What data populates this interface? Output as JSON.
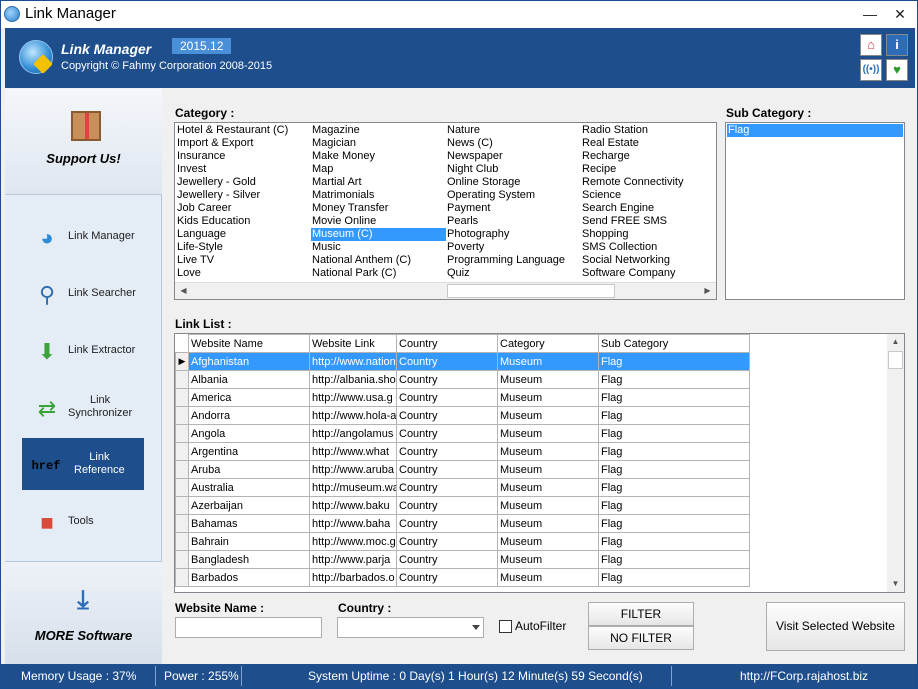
{
  "window": {
    "title": "Link Manager",
    "minimize": "—",
    "close": "✕"
  },
  "header": {
    "name": "Link Manager",
    "version": "2015.12",
    "copyright": "Copyright © Fahmy Corporation 2008-2015"
  },
  "sidebar": {
    "support": "Support Us!",
    "items": [
      {
        "label": "Link Manager",
        "icon": "globe-key-icon"
      },
      {
        "label": "Link Searcher",
        "icon": "magnifier-icon"
      },
      {
        "label": "Link Extractor",
        "icon": "green-arrow-down-icon"
      },
      {
        "label": "Link\nSynchronizer",
        "icon": "sync-arrows-icon"
      },
      {
        "label": "Link\nReference",
        "icon": "href-icon",
        "icon_text": "href",
        "active": true
      },
      {
        "label": "Tools",
        "icon": "cubes-icon"
      }
    ],
    "more": "MORE Software"
  },
  "category": {
    "label": "Category :",
    "columns": [
      [
        "Hotel & Restaurant (C)",
        "Import & Export",
        "Insurance",
        "Invest",
        "Jewellery - Gold",
        "Jewellery - Silver",
        "Job Career",
        "Kids Education",
        "Language",
        "Life-Style",
        "Live TV",
        "Love"
      ],
      [
        "Magazine",
        "Magician",
        "Make Money",
        "Map",
        "Martial Art",
        "Matrimonials",
        "Money Transfer",
        "Movie Online",
        "Museum (C)",
        "Music",
        "National Anthem (C)",
        "National Park (C)"
      ],
      [
        "Nature",
        "News (C)",
        "Newspaper",
        "Night Club",
        "Online Storage",
        "Operating System",
        "Payment",
        "Pearls",
        "Photography",
        "Poverty",
        "Programming Language",
        "Quiz"
      ],
      [
        "Radio Station",
        "Real Estate",
        "Recharge",
        "Recipe",
        "Remote Connectivity",
        "Science",
        "Search Engine",
        "Send FREE SMS",
        "Shopping",
        "SMS Collection",
        "Social Networking",
        "Software Company"
      ]
    ],
    "selected": "Museum (C)"
  },
  "subcategory": {
    "label": "Sub Category :",
    "items": [
      "Flag"
    ],
    "selected": "Flag"
  },
  "linklist": {
    "label": "Link List :",
    "headers": [
      "Website Name",
      "Website Link",
      "Country",
      "Category",
      "Sub Category"
    ],
    "rows": [
      [
        "Afghanistan",
        "http://www.nation",
        "Country",
        "Museum",
        "Flag"
      ],
      [
        "Albania",
        "http://albania.sho",
        "Country",
        "Museum",
        "Flag"
      ],
      [
        "America",
        "http://www.usa.g",
        "Country",
        "Museum",
        "Flag"
      ],
      [
        "Andorra",
        "http://www.hola-a",
        "Country",
        "Museum",
        "Flag"
      ],
      [
        "Angola",
        "http://angolamus",
        "Country",
        "Museum",
        "Flag"
      ],
      [
        "Argentina",
        "http://www.what",
        "Country",
        "Museum",
        "Flag"
      ],
      [
        "Aruba",
        "http://www.aruba",
        "Country",
        "Museum",
        "Flag"
      ],
      [
        "Australia",
        "http://museum.wa",
        "Country",
        "Museum",
        "Flag"
      ],
      [
        "Azerbaijan",
        "http://www.baku",
        "Country",
        "Museum",
        "Flag"
      ],
      [
        "Bahamas",
        "http://www.baha",
        "Country",
        "Museum",
        "Flag"
      ],
      [
        "Bahrain",
        "http://www.moc.g",
        "Country",
        "Museum",
        "Flag"
      ],
      [
        "Bangladesh",
        "http://www.parja",
        "Country",
        "Museum",
        "Flag"
      ],
      [
        "Barbados",
        "http://barbados.o",
        "Country",
        "Museum",
        "Flag"
      ]
    ],
    "selected_index": 0
  },
  "filters": {
    "website_name_label": "Website Name :",
    "website_name_value": "",
    "country_label": "Country :",
    "country_value": "",
    "autofilter_label": "AutoFilter",
    "filter_button": "FILTER",
    "nofilter_button": "NO FILTER",
    "visit_button": "Visit Selected Website"
  },
  "status": {
    "memory": "Memory Usage : 37%",
    "power": "Power : 255%",
    "uptime": "System Uptime : 0 Day(s) 1 Hour(s) 12 Minute(s) 59 Second(s)",
    "url": "http://FCorp.rajahost.biz"
  },
  "colors": {
    "accent": "#1e4e8c",
    "selection": "#3399ff"
  }
}
